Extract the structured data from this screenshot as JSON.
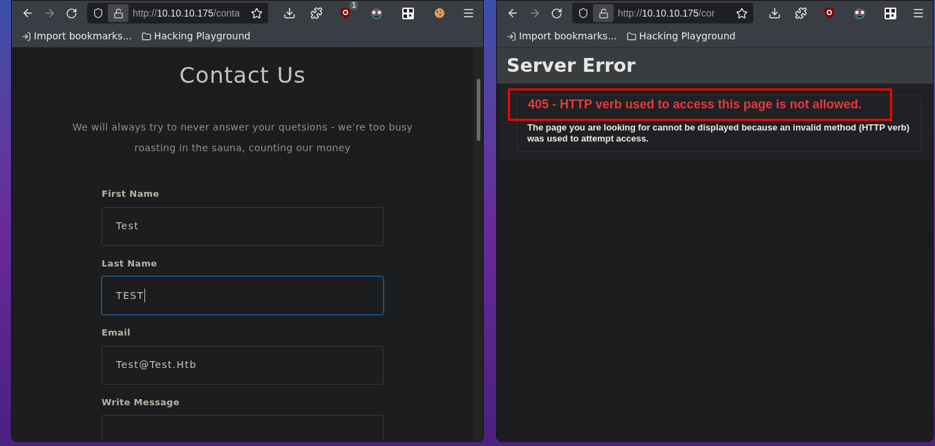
{
  "windows": [
    {
      "kind": "contact",
      "url": {
        "scheme": "http://",
        "host": "10.10.10.175",
        "path": "/conta"
      },
      "extensions": [
        {
          "kind": "ublock",
          "badge": "1"
        },
        {
          "kind": "glasses"
        },
        {
          "kind": "qr"
        },
        {
          "kind": "cookie"
        }
      ],
      "bookmarks": [
        {
          "kind": "import",
          "label": "Import bookmarks..."
        },
        {
          "kind": "folder",
          "label": "Hacking Playground"
        }
      ],
      "page": {
        "title": "Contact Us",
        "intro": "We will always try to never answer your quetsions - we’re too busy roasting in the sauna, counting our money",
        "fields": [
          {
            "label": "First Name",
            "value": "Test",
            "focused": false
          },
          {
            "label": "Last Name",
            "value": "TEST",
            "focused": true
          },
          {
            "label": "Email",
            "value": "Test@Test.Htb",
            "focused": false
          },
          {
            "label": "Write Message",
            "focused": false
          }
        ]
      }
    },
    {
      "kind": "error",
      "url": {
        "scheme": "http://",
        "host": "10.10.10.175",
        "path": "/cor"
      },
      "extensions": [
        {
          "kind": "ublock"
        },
        {
          "kind": "glasses"
        },
        {
          "kind": "qr"
        }
      ],
      "bookmarks": [
        {
          "kind": "import",
          "label": "Import bookmarks..."
        },
        {
          "kind": "folder",
          "label": "Hacking Playground"
        }
      ],
      "page": {
        "header": "Server Error",
        "error_title": "405 - HTTP verb used to access this page is not allowed.",
        "highlighted": true,
        "error_text": "The page you are looking for cannot be displayed because an invalid method (HTTP verb) was used to attempt access."
      }
    }
  ]
}
